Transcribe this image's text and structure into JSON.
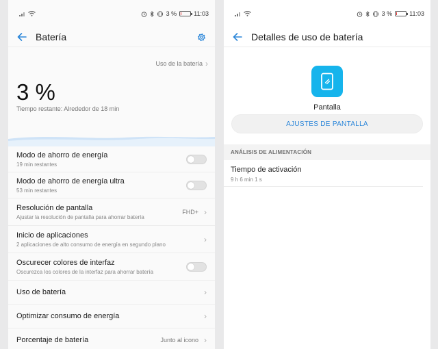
{
  "status_bar": {
    "battery_text": "3 %",
    "time": "11:03"
  },
  "left": {
    "title": "Batería",
    "usage_link": "Uso de la batería",
    "percent": "3 %",
    "remaining": "Tiempo restante: Alrededor de 18 min",
    "items": [
      {
        "title": "Modo de ahorro de energía",
        "sub": "19 min restantes",
        "control": "toggle",
        "value": ""
      },
      {
        "title": "Modo de ahorro de energía ultra",
        "sub": "53 min restantes",
        "control": "toggle",
        "value": ""
      },
      {
        "title": "Resolución de pantalla",
        "sub": "Ajustar la resolución de pantalla para ahorrar batería",
        "control": "chevron",
        "value": "FHD+"
      },
      {
        "title": "Inicio de aplicaciones",
        "sub": "2 aplicaciones de alto consumo de energía en segundo plano",
        "control": "chevron",
        "value": ""
      },
      {
        "title": "Oscurecer colores de interfaz",
        "sub": "Oscurezca los colores de la interfaz para ahorrar batería",
        "control": "toggle",
        "value": ""
      },
      {
        "title": "Uso de batería",
        "sub": "",
        "control": "chevron",
        "value": ""
      },
      {
        "title": "Optimizar consumo de energía",
        "sub": "",
        "control": "chevron",
        "value": ""
      },
      {
        "title": "Porcentaje de batería",
        "sub": "",
        "control": "chevron",
        "value": "Junto al icono"
      }
    ]
  },
  "right": {
    "title": "Detalles de uso de batería",
    "app_name": "Pantalla",
    "settings_button": "AJUSTES DE PANTALLA",
    "section_header": "ANÁLISIS DE ALIMENTACIÓN",
    "detail_title": "Tiempo de activación",
    "detail_value": "9 h 6 min 1 s"
  },
  "colors": {
    "accent": "#2b86d9",
    "app_icon": "#16b4ec"
  }
}
